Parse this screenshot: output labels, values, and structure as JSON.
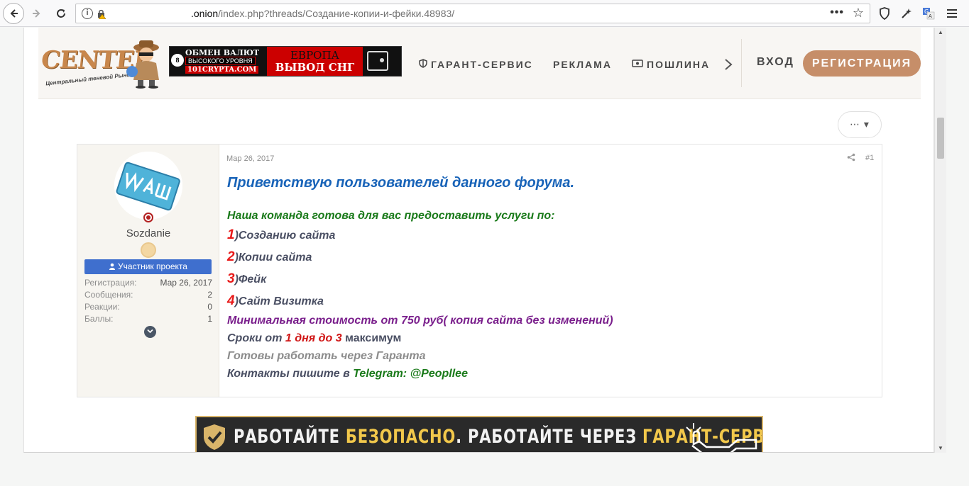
{
  "browser": {
    "url_domain": ".onion",
    "url_path": "/index.php?threads/Создание-копии-и-фейки.48983/"
  },
  "header": {
    "logo_text": "CENTER",
    "logo_subtitle": "Центральный теневой Рынок",
    "banner1": {
      "line1": "ОБМЕН ВАЛЮТ",
      "line2": "ВЫСОКОГО УРОВНЯ",
      "line3": "101CRYPTA.COM",
      "right1": "ЕВРОПА",
      "right2": "ВЫВОД СНГ"
    },
    "nav": {
      "garant": "ГАРАНТ-СЕРВИС",
      "reklama": "РЕКЛАМА",
      "poshlina": "ПОШЛИНА"
    },
    "login": "ВХОД",
    "register": "РЕГИСТРАЦИЯ"
  },
  "actions": {
    "more": "⋯ ▾"
  },
  "post": {
    "date": "Мар 26, 2017",
    "number": "#1",
    "user": {
      "name": "Sozdanie",
      "title": "Участник проекта",
      "stats": [
        {
          "label": "Регистрация:",
          "value": "Мар 26, 2017"
        },
        {
          "label": "Сообщения:",
          "value": "2"
        },
        {
          "label": "Реакции:",
          "value": "0"
        },
        {
          "label": "Баллы:",
          "value": "1"
        }
      ]
    },
    "body": {
      "greeting": "Приветствую пользователей данного форума.",
      "team": "Наша команда готова для вас предоставить услуги по:",
      "items": [
        {
          "num": "1",
          "text": ")Созданию сайта"
        },
        {
          "num": "2",
          "text": ")Копии сайта"
        },
        {
          "num": "3",
          "text": ")Фейк"
        },
        {
          "num": "4",
          "text": ")Сайт Визитка"
        }
      ],
      "price": "Минимальная стоимость от 750 руб( копия сайта без изменений)",
      "terms_prefix": "Сроки от ",
      "terms_highlight": "1 дня до 3",
      "terms_suffix": " максимум",
      "guarantee": "Готовы работать через Гаранта",
      "contacts_prefix": "Контакты пишите в ",
      "contacts_value": "Telegram: @Peopllee"
    }
  },
  "banner2": {
    "part1": "РАБОТАЙТЕ ",
    "part2": "БЕЗОПАСНО",
    "part3": ". РАБОТАЙТЕ ЧЕРЕЗ ",
    "part4": "ГАРАНТ-СЕРВИС"
  },
  "colors": {
    "accent": "#c68e69",
    "title_blue": "#3f6fce",
    "greeting_blue": "#1863b8"
  },
  "icons": [
    "back-icon",
    "forward-icon",
    "reload-icon",
    "info-icon",
    "lock-warning-icon",
    "more-dots-icon",
    "star-icon",
    "shield-icon",
    "wand-icon",
    "translate-icon",
    "menu-icon",
    "share-icon",
    "chevron-down-icon"
  ]
}
